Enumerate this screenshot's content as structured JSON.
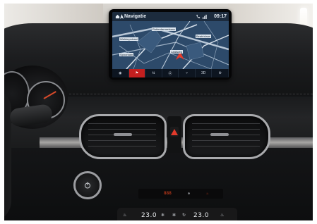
{
  "nav": {
    "title": "Navigatie",
    "time": "09:17",
    "map_labels": [
      "Rotterdamsebaan",
      "Beatrixlaan",
      "Waldorpstraat",
      "Spoorlaan",
      "Laakweg"
    ],
    "toolbar": [
      {
        "icon": "compass-icon",
        "label": "◉"
      },
      {
        "icon": "flag-icon",
        "label": "⚑"
      },
      {
        "icon": "route-icon",
        "label": "⇅"
      },
      {
        "icon": "pin-icon",
        "label": "⦿"
      },
      {
        "icon": "fork-icon",
        "label": "⑂"
      },
      {
        "icon": "3d-view",
        "label": "3D"
      },
      {
        "icon": "settings-icon",
        "label": "⚙"
      }
    ]
  },
  "climate": {
    "left_temp": "23.0",
    "right_temp": "23.0",
    "display_digits": "888"
  },
  "colors": {
    "accent": "#c21f1f",
    "screen_bg": "#27405d",
    "climate_readout": "#e2431e"
  }
}
